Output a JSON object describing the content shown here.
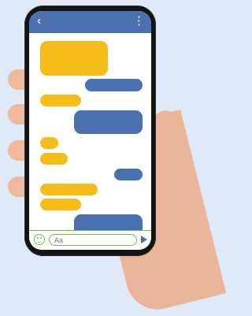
{
  "header": {
    "back_icon": "back-arrow-icon",
    "back_glyph": "‹",
    "menu_icon": "more-vertical-icon",
    "menu_glyph": "⋮"
  },
  "composer": {
    "emoji_icon": "emoji-icon",
    "input_placeholder": "Aa",
    "send_icon": "send-icon"
  },
  "colors": {
    "header": "#4a70b0",
    "incoming_bubble": "#f5bd17",
    "outgoing_bubble": "#4a70b0",
    "composer_accent": "#6abf4b",
    "screen": "#ffffff",
    "phone_body": "#141414",
    "background": "#dfe9f7"
  }
}
